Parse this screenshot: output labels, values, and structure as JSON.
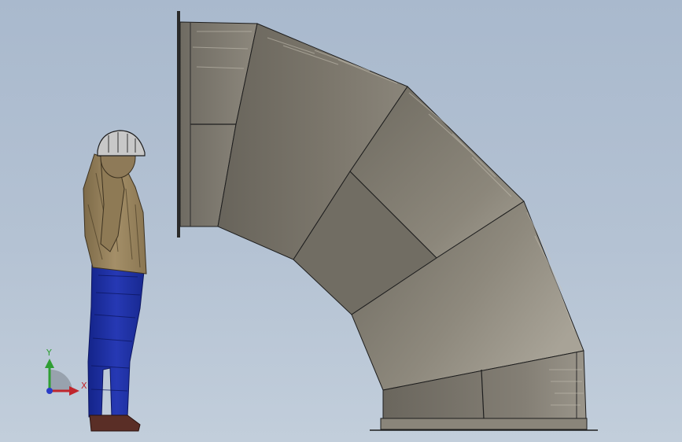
{
  "viewport": {
    "background_top": "#a9b9cd",
    "background_bottom": "#c2cedb"
  },
  "model": {
    "elbow_color": "#7d786d",
    "elbow_highlight": "#a19c90",
    "elbow_shadow": "#5f5b52",
    "flange_color": "#8c877b",
    "edge_color": "#1e1e1e"
  },
  "figure": {
    "shirt_color": "#9b8660",
    "pants_color": "#1f33a6",
    "shoe_color": "#5a2e26",
    "helmet_color": "#c8c8c8"
  },
  "triad": {
    "x_label": "X",
    "y_label": "Y",
    "x_color": "#c0262d",
    "y_color": "#2f9e34",
    "z_color": "#2a3cc7"
  }
}
